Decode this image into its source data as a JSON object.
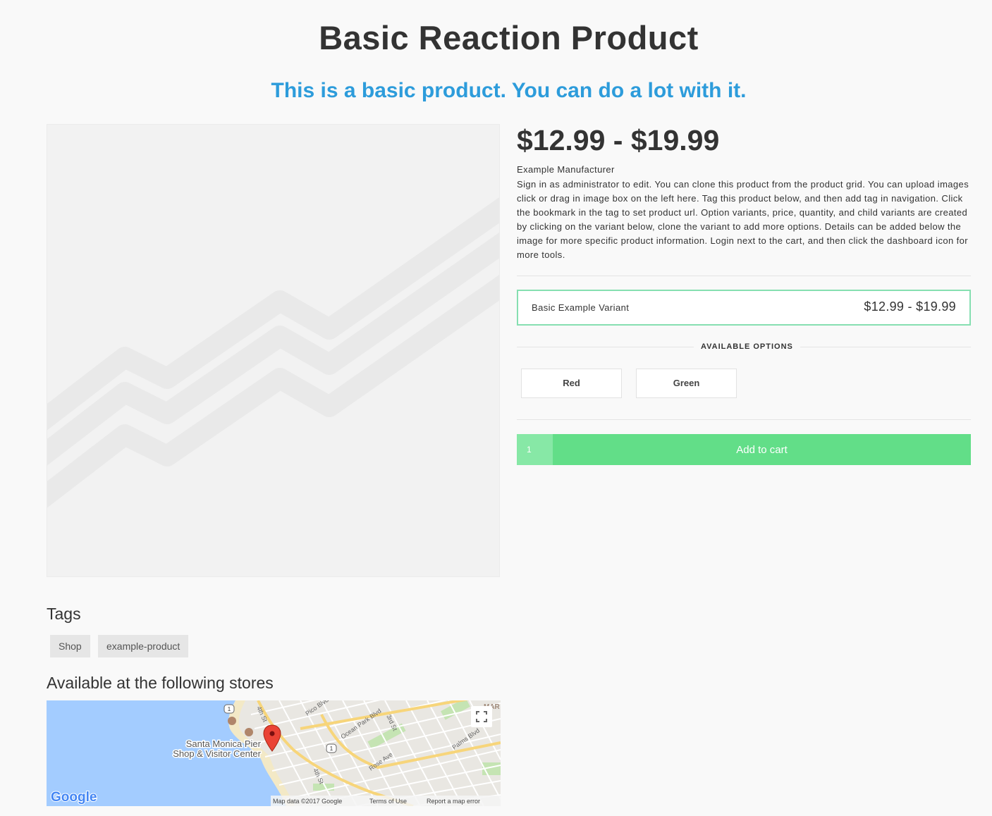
{
  "product": {
    "title": "Basic Reaction Product",
    "subtitle": "This is a basic product. You can do a lot with it.",
    "price_range": "$12.99 - $19.99",
    "vendor": "Example Manufacturer",
    "description": "Sign in as administrator to edit. You can clone this product from the product grid. You can upload images click or drag in image box on the left here. Tag this product below, and then add tag in navigation. Click the bookmark in the tag to set product url. Option variants, price, quantity, and child variants are created by clicking on the variant below, clone the variant to add more options. Details can be added below the image for more specific product information. Login next to the cart, and then click the dashboard icon for more tools."
  },
  "variant": {
    "title": "Basic Example Variant",
    "price": "$12.99 - $19.99"
  },
  "options": {
    "label": "AVAILABLE OPTIONS",
    "items": [
      "Red",
      "Green"
    ]
  },
  "cart": {
    "quantity": "1",
    "button_label": "Add to cart"
  },
  "tags": {
    "title": "Tags",
    "items": [
      "Shop",
      "example-product"
    ]
  },
  "stores": {
    "title": "Available at the following stores"
  },
  "map": {
    "place_label_1": "Santa Monica Pier",
    "place_label_2": "Shop & Visitor Center",
    "streets": [
      "Pico Blvd",
      "Ocean Park Blvd",
      "3rd St",
      "4th St",
      "4th St",
      "Rose Ave",
      "Palms Blvd"
    ],
    "route_marker": "1",
    "edge_label": "MAR",
    "logo": "Google",
    "attribution": "Map data ©2017 Google",
    "terms": "Terms of Use",
    "report": "Report a map error"
  },
  "colors": {
    "accent_blue": "#2d9cdb",
    "cart_green": "#62de88",
    "variant_border": "#86dfb1",
    "water": "#a3ccff"
  }
}
